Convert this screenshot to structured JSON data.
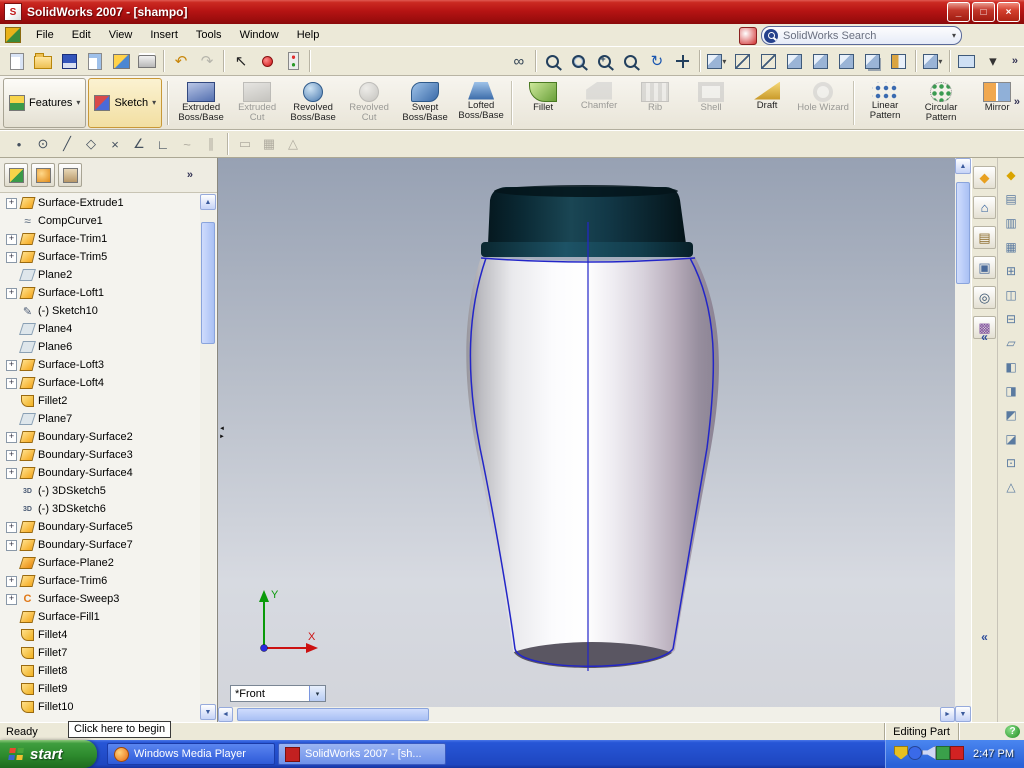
{
  "colors": {
    "titlebar_red": "#b61414",
    "taskbar_blue": "#2756d6",
    "start_green": "#2d8a2d",
    "edge_blue": "#2326c8",
    "cap_teal": "#123b47",
    "body_white": "#ffffff",
    "viewport_top": "#97a1b3",
    "viewport_bottom": "#d7dae1",
    "feature_orange": "#f5a81e"
  },
  "icons": {
    "minimize": "_",
    "maximize": "□",
    "close": "×",
    "dropdown": "▾",
    "chevron_right": "»",
    "chevron_left": "«",
    "plus": "+",
    "help": "?",
    "up": "▲",
    "down": "▼",
    "left": "◄",
    "right": "►",
    "splitter_left": "◄",
    "splitter_right": "►"
  },
  "window": {
    "title": "SolidWorks 2007 - [shampo]"
  },
  "menu": {
    "items": [
      "File",
      "Edit",
      "View",
      "Insert",
      "Tools",
      "Window",
      "Help"
    ]
  },
  "search": {
    "placeholder": "SolidWorks Search"
  },
  "main_toolbar": {
    "items": [
      {
        "name": "new-document",
        "css": "page"
      },
      {
        "name": "open-document",
        "css": "folder"
      },
      {
        "name": "save",
        "css": "disk"
      },
      {
        "name": "make-drawing-from-part",
        "css": "page2"
      },
      {
        "name": "make-assembly-from-part",
        "css": "asm"
      },
      {
        "name": "print",
        "css": "printer"
      },
      {
        "type": "sep"
      },
      {
        "name": "undo",
        "glyph": "↶",
        "color": "#c8860a"
      },
      {
        "name": "redo",
        "glyph": "↷",
        "color": "#777777",
        "disabled": true
      },
      {
        "type": "sep"
      },
      {
        "name": "select",
        "glyph": "↖",
        "color": "#222222"
      },
      {
        "name": "record-macro",
        "css": "dot"
      },
      {
        "name": "rebuild",
        "css": "rebuild"
      },
      {
        "type": "sep"
      },
      {
        "type": "gap"
      },
      {
        "name": "view-settings",
        "glyph": "∞",
        "color": "#334455"
      },
      {
        "type": "sep"
      },
      {
        "name": "zoom-to-fit",
        "css": "zoom"
      },
      {
        "name": "zoom-to-area",
        "css": "zoomrect"
      },
      {
        "name": "zoom-in-out",
        "css": "zoomplus"
      },
      {
        "name": "zoom-to-selection",
        "css": "zoom"
      },
      {
        "name": "rotate-view",
        "glyph": "↻",
        "color": "#1a56b0"
      },
      {
        "name": "pan",
        "css": "pan"
      },
      {
        "type": "sep"
      },
      {
        "name": "standard-views",
        "css": "cube",
        "dropdown": true
      },
      {
        "name": "wireframe",
        "css": "cubewire"
      },
      {
        "name": "hidden-lines-visible",
        "css": "cubewire"
      },
      {
        "name": "hidden-lines-removed",
        "css": "cube"
      },
      {
        "name": "shaded-with-edges",
        "css": "cube"
      },
      {
        "name": "shaded",
        "css": "cube"
      },
      {
        "name": "shadows-in-shaded-mode",
        "css": "cubesh"
      },
      {
        "name": "section-view",
        "css": "section"
      },
      {
        "type": "sep"
      },
      {
        "name": "view-orientation",
        "css": "cube",
        "dropdown": true
      },
      {
        "type": "sep"
      },
      {
        "name": "realview-graphics",
        "css": "screen"
      },
      {
        "name": "toolbar-options",
        "glyph": "▾",
        "color": "#333333"
      }
    ]
  },
  "command_manager": {
    "tabs": [
      {
        "label": "Features"
      },
      {
        "label": "Sketch"
      }
    ],
    "buttons": [
      {
        "label": "Extruded Boss/Base",
        "css": "extrude",
        "enabled": true
      },
      {
        "label": "Extruded Cut",
        "css": "extrudecut",
        "enabled": false
      },
      {
        "label": "Revolved Boss/Base",
        "css": "revolve",
        "enabled": true
      },
      {
        "label": "Revolved Cut",
        "css": "revolvecut",
        "enabled": false
      },
      {
        "label": "Swept Boss/Base",
        "css": "swept",
        "enabled": true
      },
      {
        "label": "Lofted Boss/Base",
        "css": "loft",
        "enabled": true
      },
      {
        "sep": true
      },
      {
        "label": "Fillet",
        "css": "fillet",
        "enabled": true
      },
      {
        "label": "Chamfer",
        "css": "chamfer",
        "enabled": false
      },
      {
        "label": "Rib",
        "css": "rib",
        "enabled": false
      },
      {
        "label": "Shell",
        "css": "shell",
        "enabled": false
      },
      {
        "label": "Draft",
        "css": "draft",
        "enabled": true
      },
      {
        "label": "Hole Wizard",
        "css": "holewizard",
        "enabled": false
      },
      {
        "sep": true
      },
      {
        "label": "Linear Pattern",
        "css": "linear",
        "enabled": true
      },
      {
        "label": "Circular Pattern",
        "css": "circular",
        "enabled": true
      },
      {
        "label": "Mirror",
        "css": "mirror",
        "enabled": true
      }
    ]
  },
  "sketch_toolbar": {
    "items": [
      {
        "name": "point",
        "glyph": "•"
      },
      {
        "name": "circle",
        "glyph": "⊙"
      },
      {
        "name": "line",
        "glyph": "╱"
      },
      {
        "name": "polygon",
        "glyph": "◇"
      },
      {
        "name": "trim-entities",
        "glyph": "×"
      },
      {
        "name": "sketch-angle",
        "glyph": "∠"
      },
      {
        "name": "perpendicular",
        "glyph": "∟"
      },
      {
        "name": "spline",
        "glyph": "~",
        "disabled": true
      },
      {
        "name": "offset-entities",
        "glyph": "∥",
        "disabled": true
      },
      {
        "type": "sep"
      },
      {
        "name": "rectangle",
        "glyph": "▭",
        "disabled": true
      },
      {
        "name": "sketch-pattern",
        "glyph": "▦",
        "disabled": true
      },
      {
        "name": "convert-entities",
        "glyph": "△",
        "disabled": true
      }
    ]
  },
  "feature_tree": {
    "items": [
      {
        "label": "Surface-Extrude1",
        "icon": "surface",
        "plus": true
      },
      {
        "label": "CompCurve1",
        "icon": "curve",
        "plus": false
      },
      {
        "label": "Surface-Trim1",
        "icon": "surface",
        "plus": true
      },
      {
        "label": "Surface-Trim5",
        "icon": "surface",
        "plus": true
      },
      {
        "label": "Plane2",
        "icon": "plane",
        "plus": false
      },
      {
        "label": "Surface-Loft1",
        "icon": "surface",
        "plus": true
      },
      {
        "label": "(-) Sketch10",
        "icon": "sketch",
        "plus": false
      },
      {
        "label": "Plane4",
        "icon": "plane",
        "plus": false
      },
      {
        "label": "Plane6",
        "icon": "plane",
        "plus": false
      },
      {
        "label": "Surface-Loft3",
        "icon": "surface",
        "plus": true
      },
      {
        "label": "Surface-Loft4",
        "icon": "surface",
        "plus": true
      },
      {
        "label": "Fillet2",
        "icon": "fillet",
        "plus": false
      },
      {
        "label": "Plane7",
        "icon": "plane",
        "plus": false
      },
      {
        "label": "Boundary-Surface2",
        "icon": "surface",
        "plus": true
      },
      {
        "label": "Boundary-Surface3",
        "icon": "surface",
        "plus": true
      },
      {
        "label": "Boundary-Surface4",
        "icon": "surface",
        "plus": true
      },
      {
        "label": "(-) 3DSketch5",
        "icon": "sketch3d",
        "plus": false
      },
      {
        "label": "(-) 3DSketch6",
        "icon": "sketch3d",
        "plus": false
      },
      {
        "label": "Boundary-Surface5",
        "icon": "surface",
        "plus": true
      },
      {
        "label": "Boundary-Surface7",
        "icon": "surface",
        "plus": true
      },
      {
        "label": "Surface-Plane2",
        "icon": "surfplane",
        "plus": false
      },
      {
        "label": "Surface-Trim6",
        "icon": "surface",
        "plus": true
      },
      {
        "label": "Surface-Sweep3",
        "icon": "sweep",
        "plus": true
      },
      {
        "label": "Surface-Fill1",
        "icon": "surface",
        "plus": false
      },
      {
        "label": "Fillet4",
        "icon": "fillet",
        "plus": false
      },
      {
        "label": "Fillet7",
        "icon": "fillet",
        "plus": false
      },
      {
        "label": "Fillet8",
        "icon": "fillet",
        "plus": false
      },
      {
        "label": "Fillet9",
        "icon": "fillet",
        "plus": false
      },
      {
        "label": "Fillet10",
        "icon": "fillet",
        "plus": false
      }
    ]
  },
  "viewport": {
    "view_selector": "*Front",
    "triad": {
      "x": "X",
      "y": "Y"
    }
  },
  "task_pane": {
    "items": [
      {
        "name": "solidworks-resources",
        "glyph": "◆",
        "color": "#e8a020"
      },
      {
        "name": "home",
        "glyph": "⌂",
        "color": "#2a5a9a"
      },
      {
        "name": "design-library",
        "glyph": "▤",
        "color": "#8a6a2a"
      },
      {
        "name": "file-explorer",
        "glyph": "▣",
        "color": "#4a6a9a"
      },
      {
        "name": "search-results",
        "glyph": "◎",
        "color": "#34506e"
      },
      {
        "name": "view-palette",
        "glyph": "▩",
        "color": "#7a4a9a"
      }
    ]
  },
  "right_toolbar": {
    "items": [
      {
        "name": "instant3d",
        "glyph": "◆",
        "color": "#d9a400"
      },
      {
        "name": "extruded-surface",
        "glyph": "▤",
        "color": "#5a7aa0"
      },
      {
        "name": "revolved-surface",
        "glyph": "▥",
        "color": "#5a7aa0"
      },
      {
        "name": "swept-surface",
        "glyph": "▦",
        "color": "#5a7aa0"
      },
      {
        "name": "lofted-surface",
        "glyph": "⊞",
        "color": "#5a7aa0"
      },
      {
        "name": "boundary-surface",
        "glyph": "◫",
        "color": "#5a7aa0"
      },
      {
        "name": "filled-surface",
        "glyph": "⊟",
        "color": "#5a7aa0"
      },
      {
        "name": "planar-surface",
        "glyph": "▱",
        "color": "#5a7aa0"
      },
      {
        "name": "offset-surface",
        "glyph": "◧",
        "color": "#5a7aa0"
      },
      {
        "name": "ruled-surface",
        "glyph": "◨",
        "color": "#5a7aa0"
      },
      {
        "name": "extend-surface",
        "glyph": "◩",
        "color": "#5a7aa0"
      },
      {
        "name": "trim-surface",
        "glyph": "◪",
        "color": "#5a7aa0"
      },
      {
        "name": "knit-surface",
        "glyph": "⊡",
        "color": "#5a7aa0"
      },
      {
        "name": "thicken",
        "glyph": "△",
        "color": "#5a7aa0"
      }
    ]
  },
  "status_bar": {
    "ready": "Ready",
    "tooltip": "Click here to begin",
    "editing": "Editing Part"
  },
  "taskbar": {
    "start_label": "start",
    "tasks": [
      {
        "label": "Windows Media Player",
        "active": false
      },
      {
        "label": "SolidWorks 2007 - [sh...",
        "active": true
      }
    ],
    "tray_icons": [
      {
        "name": "security-center-icon",
        "color": "#e8c020",
        "shape": "shield"
      },
      {
        "name": "messenger-icon",
        "color": "#3a6ae8",
        "shape": "round"
      },
      {
        "name": "volume-icon",
        "color": "#cfd8f4",
        "shape": "speaker"
      },
      {
        "name": "network-icon",
        "color": "#3aa04a",
        "shape": "square"
      },
      {
        "name": "solidworks-tray-icon",
        "color": "#d22222",
        "shape": "square"
      }
    ],
    "tray_time": "2:47 PM"
  }
}
